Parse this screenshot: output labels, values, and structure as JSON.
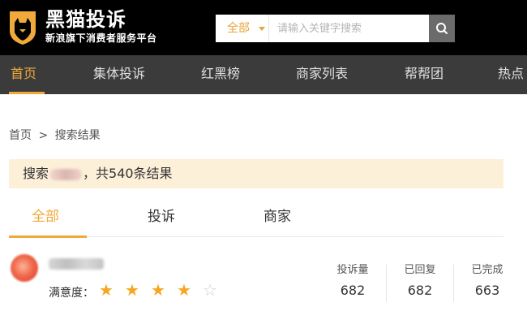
{
  "brand": {
    "title": "黑猫投诉",
    "subtitle": "新浪旗下消费者服务平台"
  },
  "search": {
    "scope": "全部",
    "placeholder": "请输入关键字搜索",
    "value": ""
  },
  "nav": {
    "items": [
      {
        "label": "首页",
        "active": true
      },
      {
        "label": "集体投诉",
        "active": false
      },
      {
        "label": "红黑榜",
        "active": false
      },
      {
        "label": "商家列表",
        "active": false
      },
      {
        "label": "帮帮团",
        "active": false
      },
      {
        "label": "热点",
        "active": false
      }
    ]
  },
  "breadcrumb": {
    "home": "首页",
    "separator": ">",
    "current": "搜索结果"
  },
  "results": {
    "prefix": "搜索",
    "suffix": "，共540条结果"
  },
  "tabs": [
    {
      "label": "全部",
      "active": true
    },
    {
      "label": "投诉",
      "active": false
    },
    {
      "label": "商家",
      "active": false
    }
  ],
  "merchant": {
    "rating_label": "满意度：",
    "rating": 4,
    "rating_max": 5,
    "stats": [
      {
        "label": "投诉量",
        "value": "682"
      },
      {
        "label": "已回复",
        "value": "682"
      },
      {
        "label": "已完成",
        "value": "663"
      }
    ]
  },
  "colors": {
    "accent": "#f0a93a",
    "header_bg": "#000000",
    "nav_bg": "#3b3b3b",
    "result_bar_bg": "#fdf0d9",
    "star_on": "#f5a623"
  }
}
